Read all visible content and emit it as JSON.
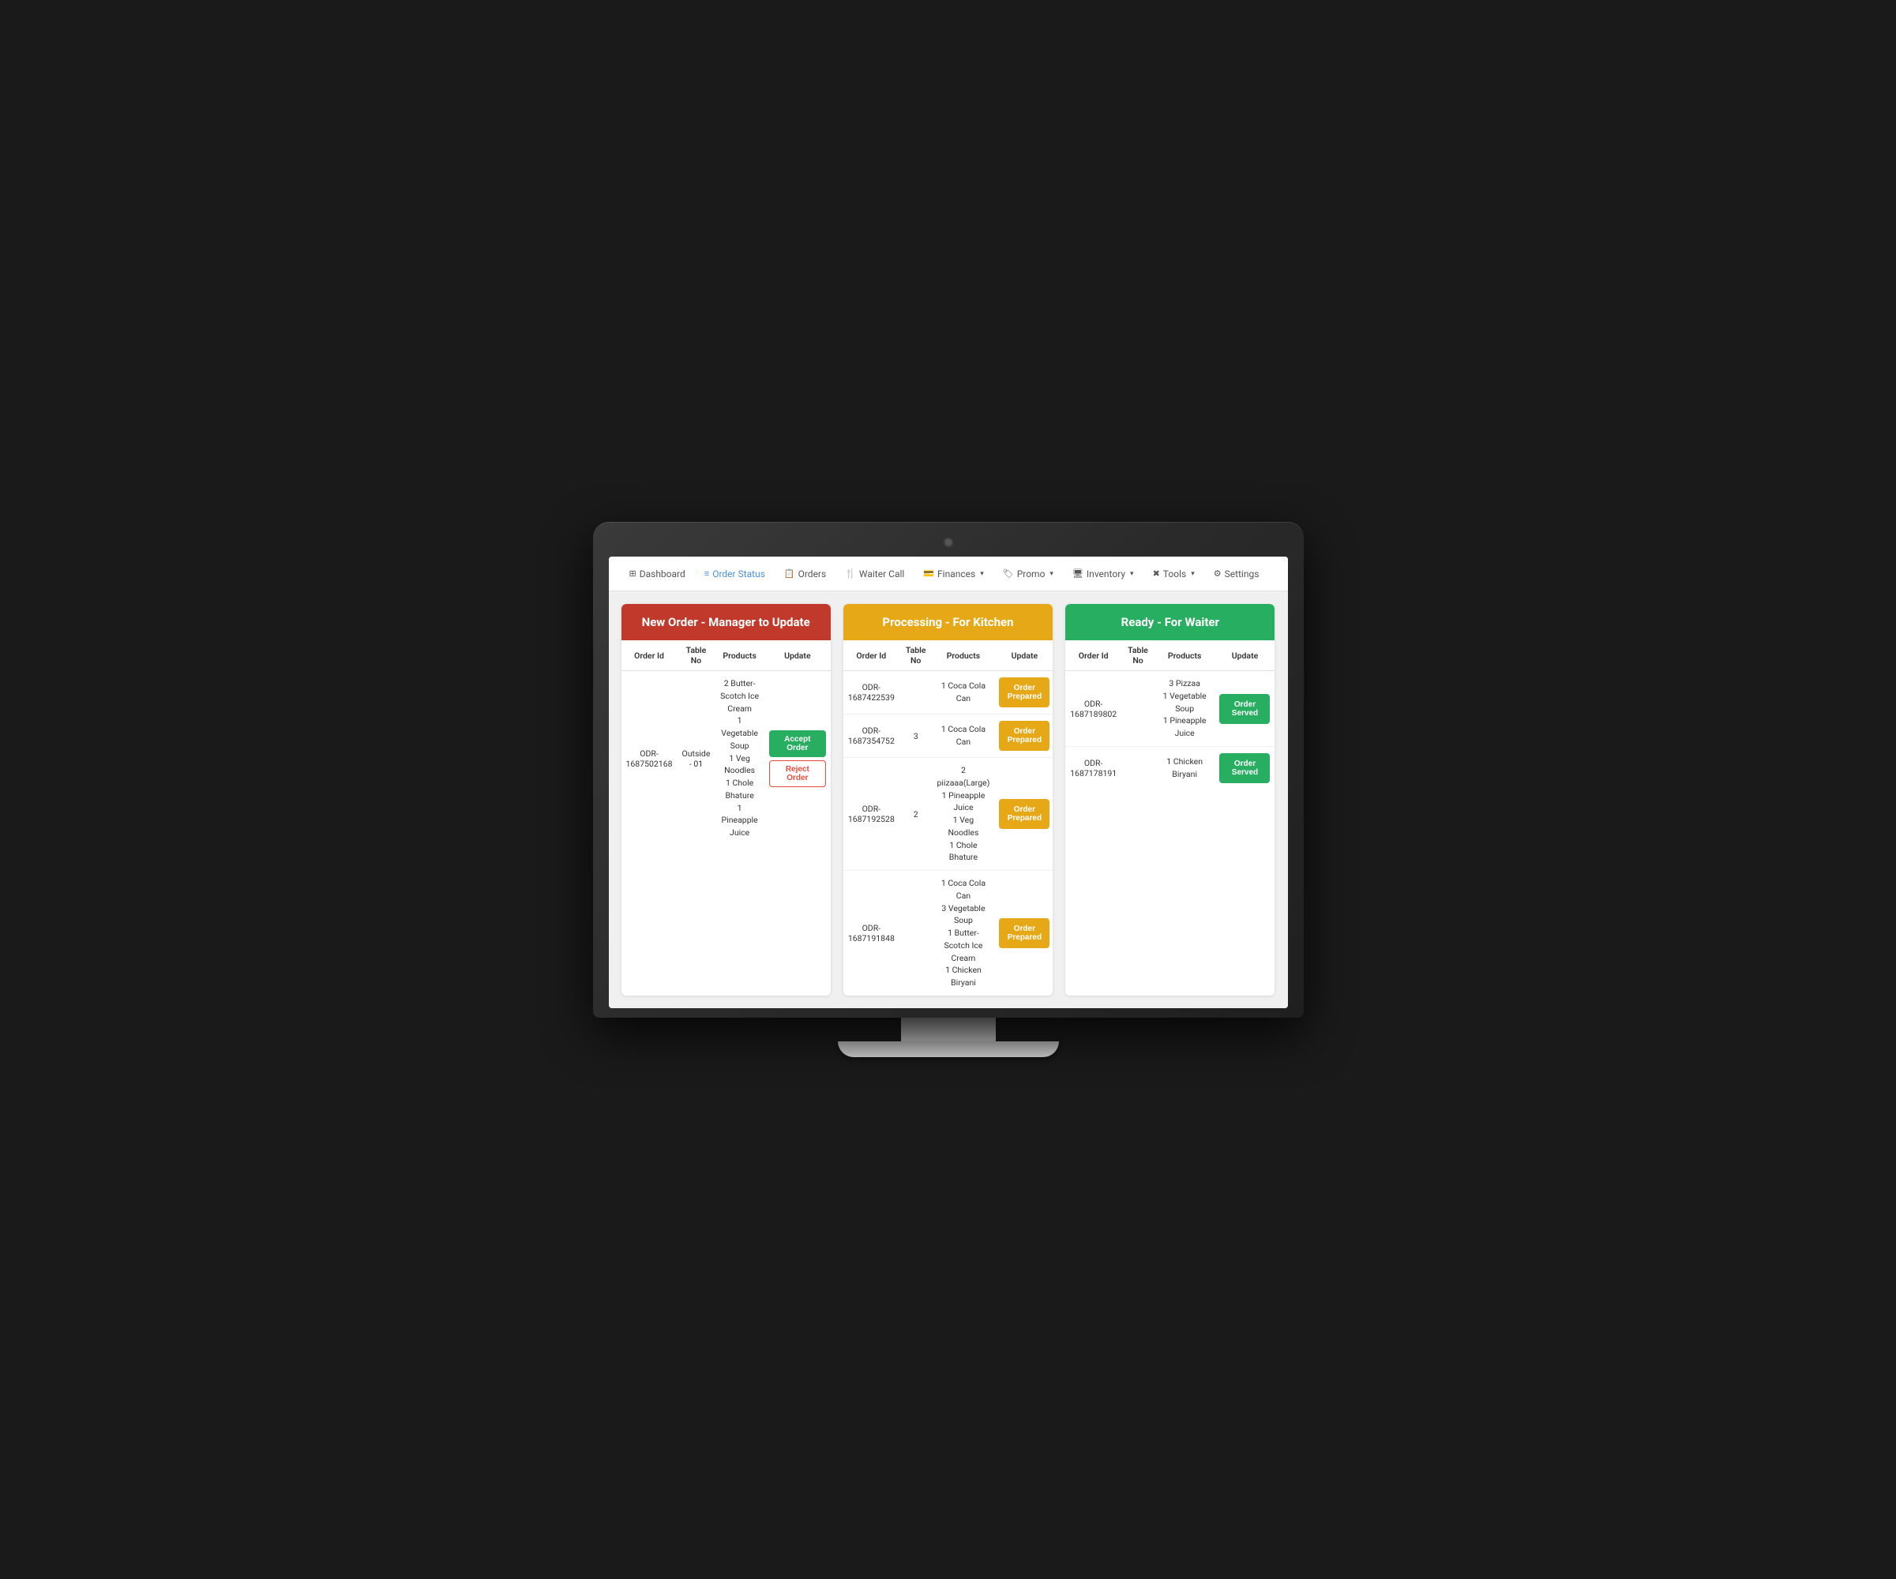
{
  "nav": {
    "items": [
      {
        "label": "Dashboard",
        "icon": "⊞",
        "active": false,
        "hasDropdown": false
      },
      {
        "label": "Order Status",
        "icon": "≡",
        "active": true,
        "hasDropdown": false
      },
      {
        "label": "Orders",
        "icon": "📋",
        "active": false,
        "hasDropdown": false
      },
      {
        "label": "Waiter Call",
        "icon": "🍴",
        "active": false,
        "hasDropdown": false
      },
      {
        "label": "Finances",
        "icon": "💳",
        "active": false,
        "hasDropdown": true
      },
      {
        "label": "Promo",
        "icon": "🏷",
        "active": false,
        "hasDropdown": true
      },
      {
        "label": "Inventory",
        "icon": "🖥",
        "active": false,
        "hasDropdown": true
      },
      {
        "label": "Tools",
        "icon": "✖",
        "active": false,
        "hasDropdown": true
      },
      {
        "label": "Settings",
        "icon": "⚙",
        "active": false,
        "hasDropdown": false
      }
    ]
  },
  "columns": {
    "new_order": {
      "header": "New Order - Manager to Update",
      "color": "red",
      "headers": [
        "Order Id",
        "Table No",
        "Products",
        "Update"
      ],
      "rows": [
        {
          "order_id": "ODR-1687502168",
          "table_no": "Outside - 01",
          "products": "2 Butter-Scotch Ice Cream\n1 Vegetable Soup\n1 Veg Noodles\n1 Chole Bhature\n1 Pineapple Juice",
          "accept_label": "Accept Order",
          "reject_label": "Reject Order"
        }
      ]
    },
    "processing": {
      "header": "Processing - For Kitchen",
      "color": "orange",
      "headers": [
        "Order Id",
        "Table No",
        "Products",
        "Update"
      ],
      "rows": [
        {
          "order_id": "ODR-1687422539",
          "table_no": "",
          "products": "1 Coca Cola Can",
          "btn_label": "Order Prepared"
        },
        {
          "order_id": "ODR-1687354752",
          "table_no": "3",
          "products": "1 Coca Cola Can",
          "btn_label": "Order Prepared"
        },
        {
          "order_id": "ODR-1687192528",
          "table_no": "2",
          "products": "2 piizaaa(Large)\n1 Pineapple Juice\n1 Veg Noodles\n1 Chole Bhature",
          "btn_label": "Order Prepared"
        },
        {
          "order_id": "ODR-1687191848",
          "table_no": "",
          "products": "1 Coca Cola Can\n3 Vegetable Soup\n1 Butter-Scotch Ice Cream\n1 Chicken Biryani",
          "btn_label": "Order Prepared"
        }
      ]
    },
    "ready": {
      "header": "Ready - For Waiter",
      "color": "green",
      "headers": [
        "Order Id",
        "Table No",
        "Products",
        "Update"
      ],
      "rows": [
        {
          "order_id": "ODR-1687189802",
          "table_no": "",
          "products": "3 Pizzaa\n1 Vegetable Soup\n1 Pineapple Juice",
          "btn_label": "Order Served"
        },
        {
          "order_id": "ODR-1687178191",
          "table_no": "",
          "products": "1 Chicken Biryani",
          "btn_label": "Order Served"
        }
      ]
    }
  }
}
